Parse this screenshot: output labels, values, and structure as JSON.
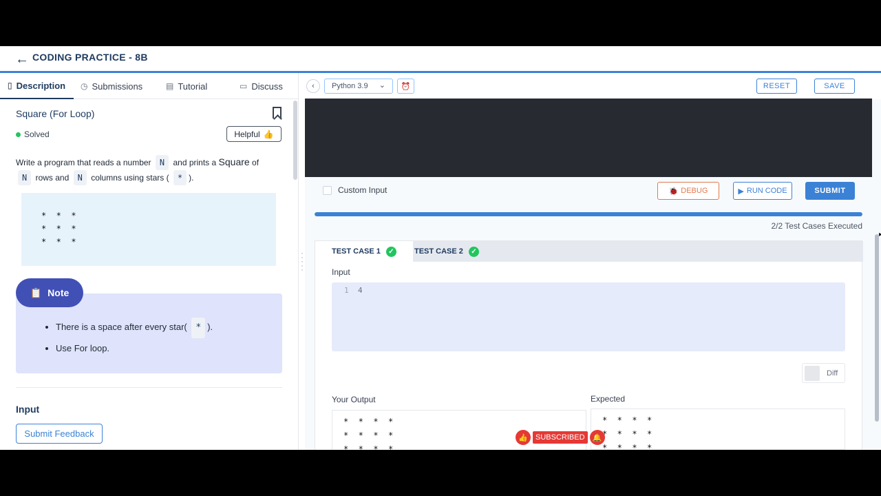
{
  "header": {
    "title": "CODING PRACTICE - 8B",
    "back_icon": "←"
  },
  "left": {
    "tabs": [
      {
        "label": "Description",
        "icon": "▯"
      },
      {
        "label": "Submissions",
        "icon": "◷"
      },
      {
        "label": "Tutorial",
        "icon": "▤"
      },
      {
        "label": "Discuss",
        "icon": "▭"
      }
    ],
    "question_title": "Square (For Loop)",
    "status": "Solved",
    "helpful_label": "Helpful",
    "description": {
      "part1": "Write a program that reads a number",
      "n": "N",
      "part2": "and prints a",
      "square": "Square",
      "part3": "of",
      "part4": "rows and",
      "part5": "columns using stars (",
      "star": "*",
      "part6": ")."
    },
    "sample_output": "*  *  *\n*  *  *\n*  *  *",
    "note": {
      "label": "Note",
      "item1_a": "There is a space after every star(",
      "item1_star": "*",
      "item1_b": ").",
      "item2": "Use For loop."
    },
    "input_heading": "Input",
    "feedback_button": "Submit Feedback"
  },
  "right": {
    "language": "Python 3.9",
    "reset_label": "RESET",
    "save_label": "SAVE",
    "custom_input_label": "Custom Input",
    "debug_label": "DEBUG",
    "run_label": "RUN CODE",
    "submit_label": "SUBMIT",
    "progress": 1.0,
    "executed_text": "2/2 Test Cases Executed",
    "test_cases": [
      {
        "label": "TEST CASE 1"
      },
      {
        "label": "TEST CASE 2"
      }
    ],
    "input_label": "Input",
    "input_line_number": "1",
    "input_value": "4",
    "diff_label": "Diff",
    "your_output_label": "Your Output",
    "expected_label": "Expected",
    "your_output": "*  *  *  *\n*  *  *  *\n*  *  *  *",
    "expected": "*  *  *  *\n*  *  *  *\n*  *  *  *"
  },
  "overlay": {
    "subscribed_text": "SUBSCRIBED"
  }
}
